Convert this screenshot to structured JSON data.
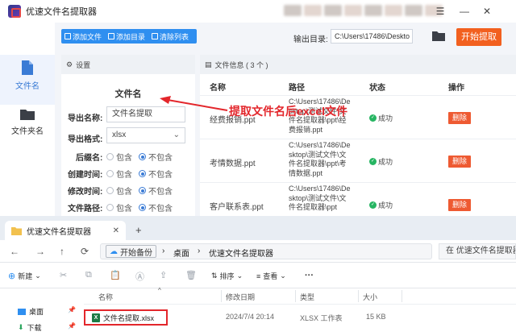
{
  "app": {
    "title": "优速文件名提取器",
    "window_controls": {
      "menu": "☰",
      "minimize": "—",
      "close": "✕"
    },
    "sidebar": [
      {
        "label": "文件名",
        "icon": "file-icon",
        "active": true
      },
      {
        "label": "文件夹名",
        "icon": "folder-icon",
        "active": false
      }
    ],
    "toolbar": {
      "add_file": "添加文件",
      "add_folder": "添加目录",
      "clear_list": "清除列表",
      "output_label": "输出目录:",
      "output_path": "C:\\Users\\17486\\Deskto",
      "start_button": "开始提取"
    },
    "settings": {
      "header": "设置",
      "section_title": "文件名",
      "export_name_label": "导出名称:",
      "export_name_value": "文件名提取",
      "export_format_label": "导出格式:",
      "export_format_value": "xlsx",
      "option_include": "包含",
      "option_exclude": "不包含",
      "rows": [
        {
          "label": "后缀名:",
          "selected": "exclude"
        },
        {
          "label": "创建时间:",
          "selected": "exclude"
        },
        {
          "label": "修改时间:",
          "selected": "exclude"
        },
        {
          "label": "文件路径:",
          "selected": "exclude"
        }
      ]
    },
    "files": {
      "header": "文件信息 ( 3 个 )",
      "columns": {
        "name": "名称",
        "path": "路径",
        "status": "状态",
        "action": "操作"
      },
      "rows": [
        {
          "name": "经费报销.ppt",
          "path": "C:\\Users\\17486\\Desktop\\测试文件\\文件名提取器\\ppt\\经费报销.ppt",
          "status": "成功",
          "action": "删除"
        },
        {
          "name": "考情数据.ppt",
          "path": "C:\\Users\\17486\\Desktop\\测试文件\\文件名提取器\\ppt\\考情数据.ppt",
          "status": "成功",
          "action": "删除"
        },
        {
          "name": "客户联系表.ppt",
          "path": "C:\\Users\\17486\\Desktop\\测试文件\\文件名提取器\\ppt",
          "status": "成功",
          "action": "删除"
        }
      ]
    }
  },
  "explorer": {
    "tab_title": "优速文件名提取器",
    "tab_close": "✕",
    "new_tab": "+",
    "breadcrumb": {
      "root": "开始备份",
      "sep": "›",
      "desktop": "桌面",
      "folder": "优速文件名提取器"
    },
    "search_placeholder": "在 优速文件名提取器",
    "commands": {
      "new": "新建",
      "sort": "排序",
      "view": "查看",
      "more": "···"
    },
    "nav_pane": [
      {
        "label": "桌面",
        "pin": "📌"
      },
      {
        "label": "下载",
        "pin": "📌"
      }
    ],
    "columns": {
      "name": "名称",
      "modified": "修改日期",
      "type": "类型",
      "size": "大小"
    },
    "file": {
      "name": "文件名提取.xlsx",
      "modified": "2024/7/4 20:14",
      "type": "XLSX 工作表",
      "size": "15 KB"
    },
    "annotation": "提取文件名后excel文件"
  }
}
